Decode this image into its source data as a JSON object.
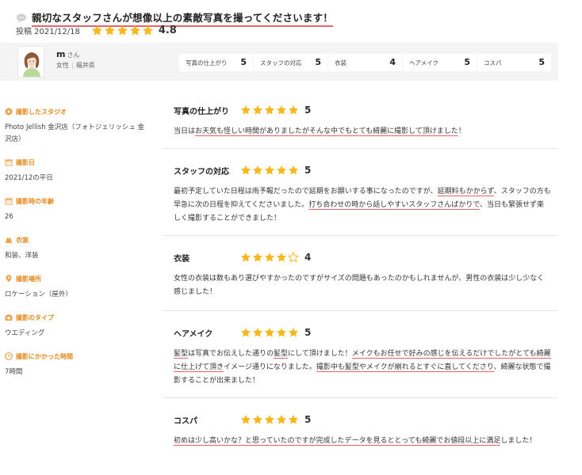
{
  "header": {
    "title": "親切なスタッフさんが想像以上の素敵写真を撮ってくださいます！",
    "posted_label": "投稿 2021/12/18",
    "overall_score": "4.8",
    "overall_stars": 5,
    "colors": {
      "accent_star": "#f6b81a",
      "underline": "#e6656b",
      "sidebar_head": "#e8891c"
    }
  },
  "profile": {
    "name": "m",
    "honorific": "さん",
    "gender": "女性",
    "prefecture": "福井県",
    "ratings": [
      {
        "label": "写真の仕上がり",
        "value": "5"
      },
      {
        "label": "スタッフの対応",
        "value": "5"
      },
      {
        "label": "衣装",
        "value": "4"
      },
      {
        "label": "ヘアメイク",
        "value": "5"
      },
      {
        "label": "コスパ",
        "value": "5"
      }
    ]
  },
  "sidebar": {
    "items": [
      {
        "icon": "studio-icon",
        "heading": "撮影したスタジオ",
        "value": "Photo Jellish 金沢店（フォトジェリッシュ 金沢店）"
      },
      {
        "icon": "calendar-icon",
        "heading": "撮影日",
        "value": "2021/12の平日"
      },
      {
        "icon": "calendar-icon",
        "heading": "撮影時の年齢",
        "value": "26"
      },
      {
        "icon": "costume-icon",
        "heading": "衣装",
        "value": "和装、洋装"
      },
      {
        "icon": "location-pin-icon",
        "heading": "撮影場所",
        "value": "ロケーション（屋外）"
      },
      {
        "icon": "camera-icon",
        "heading": "撮影のタイプ",
        "value": "ウエディング"
      },
      {
        "icon": "clock-icon",
        "heading": "撮影にかかった時間",
        "value": "7時間"
      }
    ]
  },
  "reviews": [
    {
      "title": "写真の仕上がり",
      "score": "5",
      "stars": 5,
      "text_parts": [
        {
          "t": "当日は",
          "u": false
        },
        {
          "t": "お天気も怪しい時間がありましたがそんな中でもとても綺麗に撮影して頂けました",
          "u": true
        },
        {
          "t": "！",
          "u": false
        }
      ]
    },
    {
      "title": "スタッフの対応",
      "score": "5",
      "stars": 5,
      "text_parts": [
        {
          "t": "最初予定していた日程は雨予報だったので延期をお願いする事になったのですが、",
          "u": false
        },
        {
          "t": "延期料もかからず",
          "u": true
        },
        {
          "t": "、スタッフの方も早急に次の日程を抑えてくださいました。",
          "u": false
        },
        {
          "t": "打ち合わせの時から話しやすいスタッフさんばかりで",
          "u": true
        },
        {
          "t": "、当日も緊張せず楽しく撮影することができました！",
          "u": false
        }
      ]
    },
    {
      "title": "衣装",
      "score": "4",
      "stars": 4,
      "text_parts": [
        {
          "t": "女性の衣装は数もあり選びやすかったのですがサイズの問題もあったのかもしれませんが、男性の衣装は少し少なく感じました！",
          "u": false
        }
      ]
    },
    {
      "title": "ヘアメイク",
      "score": "5",
      "stars": 5,
      "text_parts": [
        {
          "t": "髪型",
          "u": true
        },
        {
          "t": "は写真でお伝えした通りの",
          "u": false
        },
        {
          "t": "髪型",
          "u": true
        },
        {
          "t": "にして頂けました！",
          "u": false
        },
        {
          "t": "メイクもお任せで好みの感じを伝えるだけでしたがとても綺麗に仕上げて頂き",
          "u": true
        },
        {
          "t": "イメージ通りになりました。",
          "u": false
        },
        {
          "t": "撮影中も髪型やメイクが崩れるとすぐに直してくださり",
          "u": true
        },
        {
          "t": "、綺麗な状態で撮影することが出来ました！",
          "u": false
        }
      ]
    },
    {
      "title": "コスパ",
      "score": "5",
      "stars": 5,
      "text_parts": [
        {
          "t": "初めは少し高いかな？と思っていたのですが完成したデータを見るととっても綺麗でお値段以上に満足",
          "u": true
        },
        {
          "t": "しました！",
          "u": false
        }
      ]
    }
  ]
}
